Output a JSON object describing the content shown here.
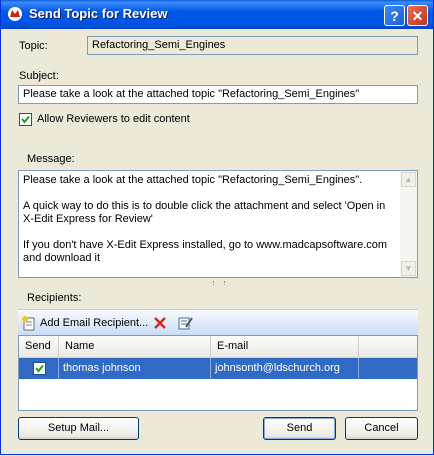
{
  "window": {
    "title": "Send Topic for Review",
    "help_label": "?",
    "close_label": "✕"
  },
  "topic": {
    "label": "Topic:",
    "value": "Refactoring_Semi_Engines"
  },
  "subject": {
    "label": "Subject:",
    "value": "Please take a look at the attached topic \"Refactoring_Semi_Engines\""
  },
  "allow_edit": {
    "label": "Allow Reviewers to edit content",
    "checked": true
  },
  "message": {
    "label": "Message:",
    "paragraphs": [
      "Please take a look at the attached topic \"Refactoring_Semi_Engines\".",
      "A quick way to do this is to double click the attachment and select 'Open in X-Edit Express for Review'",
      "If you don't have X-Edit Express installed, go to www.madcapsoftware.com and download it"
    ]
  },
  "recipients": {
    "label": "Recipients:",
    "add_label": "Add Email Recipient...",
    "columns": [
      "Send",
      "Name",
      "E-mail"
    ],
    "rows": [
      {
        "send": true,
        "name": "thomas johnson",
        "email": "johnsonth@ldschurch.org"
      }
    ]
  },
  "buttons": {
    "setup_mail": "Setup Mail...",
    "send": "Send",
    "cancel": "Cancel"
  },
  "colors": {
    "title_bar": "#0054e3",
    "selection": "#316ac5",
    "dialog_bg": "#ece9d8",
    "delete_icon": "#d9251d"
  }
}
